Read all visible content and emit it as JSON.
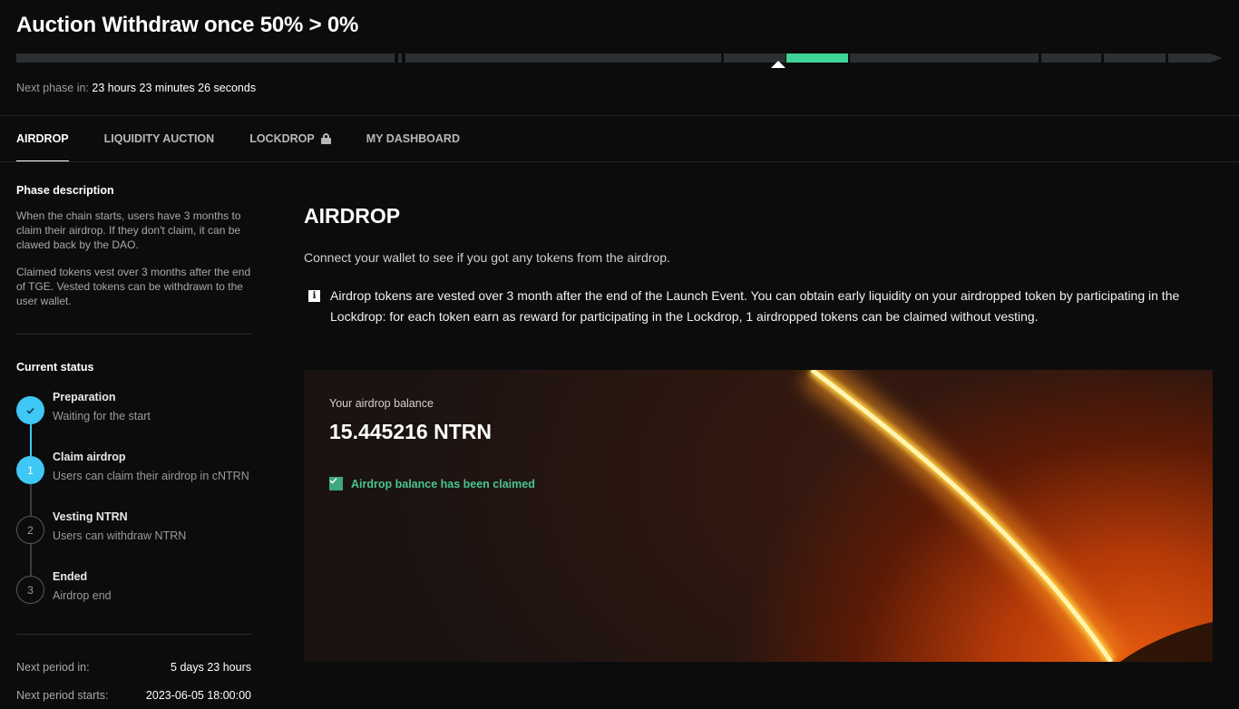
{
  "header": {
    "phase_title": "Auction Withdraw once 50% > 0%",
    "next_phase_label": "Next phase in:",
    "next_phase_value": "23 hours 23 minutes 26 seconds"
  },
  "colors": {
    "accent_green": "#3ed598",
    "step_blue": "#3fc7f5",
    "background": "#0c0c0c"
  },
  "tabs": [
    {
      "label": "AIRDROP",
      "active": true
    },
    {
      "label": "LIQUIDITY AUCTION",
      "active": false
    },
    {
      "label": "LOCKDROP",
      "active": false,
      "icon": "lock-icon"
    },
    {
      "label": "MY DASHBOARD",
      "active": false
    }
  ],
  "sidebar": {
    "phase_description_heading": "Phase description",
    "phase_description_p1": "When the chain starts, users have 3 months to claim their airdrop. If they don't claim, it can be clawed back by the DAO.",
    "phase_description_p2": "Claimed tokens vest over 3 months after the end of TGE. Vested tokens can be withdrawn to the user wallet.",
    "current_status_heading": "Current status",
    "steps": [
      {
        "marker": "✓",
        "title": "Preparation",
        "subtitle": "Waiting for the start",
        "state": "done"
      },
      {
        "marker": "1",
        "title": "Claim airdrop",
        "subtitle": "Users can claim their airdrop in cNTRN",
        "state": "current"
      },
      {
        "marker": "2",
        "title": "Vesting NTRN",
        "subtitle": "Users can withdraw NTRN",
        "state": "todo"
      },
      {
        "marker": "3",
        "title": "Ended",
        "subtitle": "Airdrop end",
        "state": "todo"
      }
    ],
    "next_period_in_label": "Next period in:",
    "next_period_in_value": "5 days 23 hours",
    "next_period_starts_label": "Next period starts:",
    "next_period_starts_value": "2023-06-05 18:00:00"
  },
  "main": {
    "title": "AIRDROP",
    "subtitle": "Connect your wallet to see if you got any tokens from the airdrop.",
    "info_icon": "i",
    "info_text": "Airdrop tokens are vested over 3 month after the end of the Launch Event. You can obtain early liquidity on your airdropped token by participating in the Lockdrop: for each token earn as reward for participating in the Lockdrop, 1 airdropped tokens can be claimed without vesting.",
    "card": {
      "label": "Your airdrop balance",
      "balance": "15.445216 NTRN",
      "claimed_text": "Airdrop balance has been claimed",
      "claimed": true
    }
  }
}
